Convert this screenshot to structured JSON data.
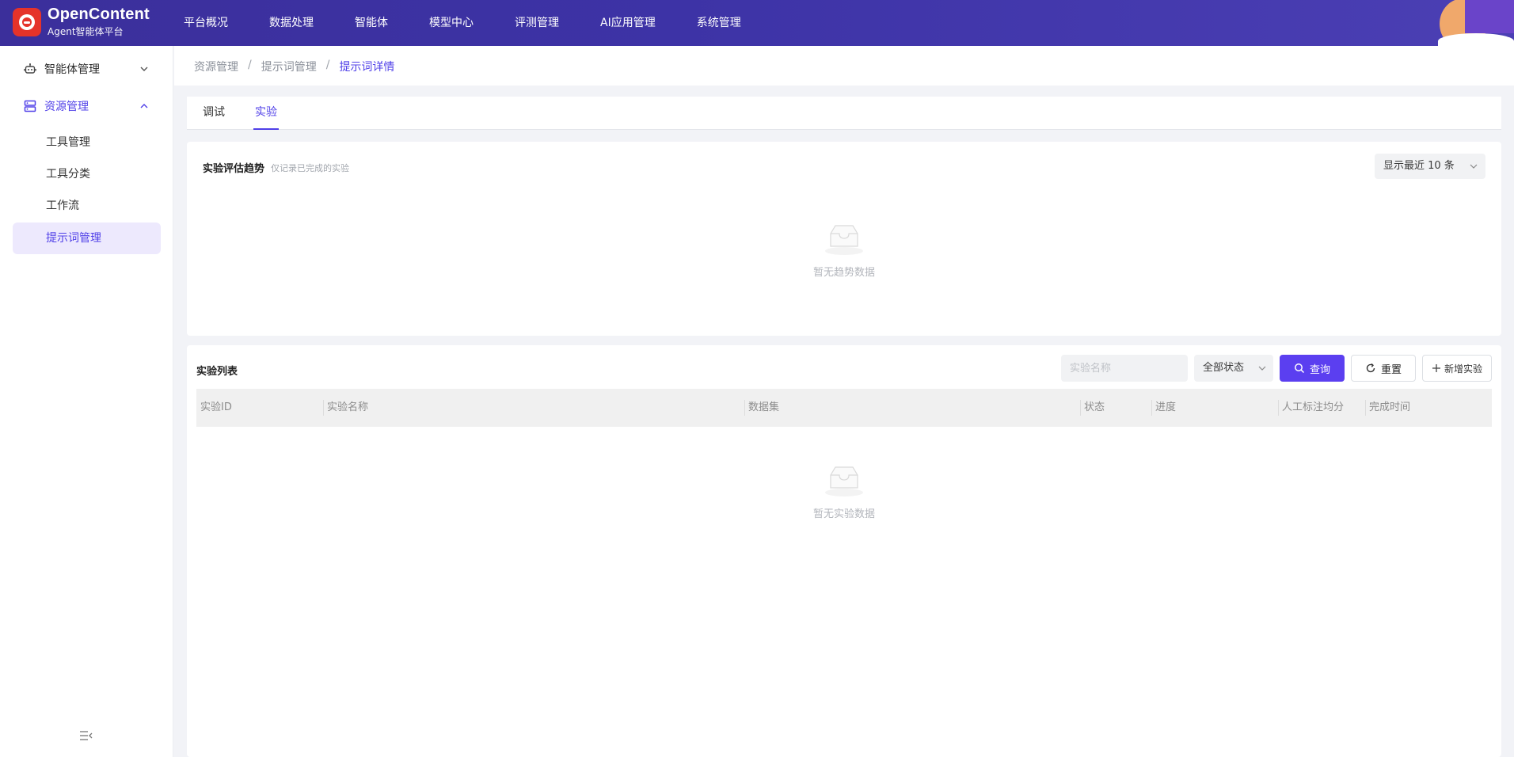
{
  "brand": {
    "name": "OpenContent",
    "subtitle": "Agent智能体平台"
  },
  "nav": {
    "items": [
      "平台概况",
      "数据处理",
      "智能体",
      "模型中心",
      "评测管理",
      "AI应用管理",
      "系统管理"
    ]
  },
  "sidebar": {
    "groups": [
      {
        "label": "智能体管理",
        "icon": "robot-icon",
        "expanded": false
      },
      {
        "label": "资源管理",
        "icon": "server-icon",
        "expanded": true
      }
    ],
    "items": [
      "工具管理",
      "工具分类",
      "工作流",
      "提示词管理"
    ],
    "selected_item": "提示词管理",
    "collapse_icon": "menu-fold-icon"
  },
  "breadcrumb": {
    "items": [
      "资源管理",
      "提示词管理",
      "提示词详情"
    ],
    "separator": "/"
  },
  "tabs": {
    "items": [
      "调试",
      "实验"
    ],
    "active": "实验"
  },
  "trend": {
    "title": "实验评估趋势",
    "hint": "仅记录已完成的实验",
    "recent_select": "显示最近 10 条",
    "empty_text": "暂无趋势数据"
  },
  "experiments": {
    "title": "实验列表",
    "search_placeholder": "实验名称",
    "status_select": "全部状态",
    "query_button": "查询",
    "reset_button": "重置",
    "add_button": "新增实验",
    "columns": [
      "实验ID",
      "实验名称",
      "数据集",
      "状态",
      "进度",
      "人工标注均分",
      "完成时间"
    ],
    "rows": [],
    "empty_text": "暂无实验数据"
  },
  "colors": {
    "accent": "#4f3fe8",
    "primary_button": "#5b3ff0",
    "nav_bg": "#3d33a6"
  }
}
